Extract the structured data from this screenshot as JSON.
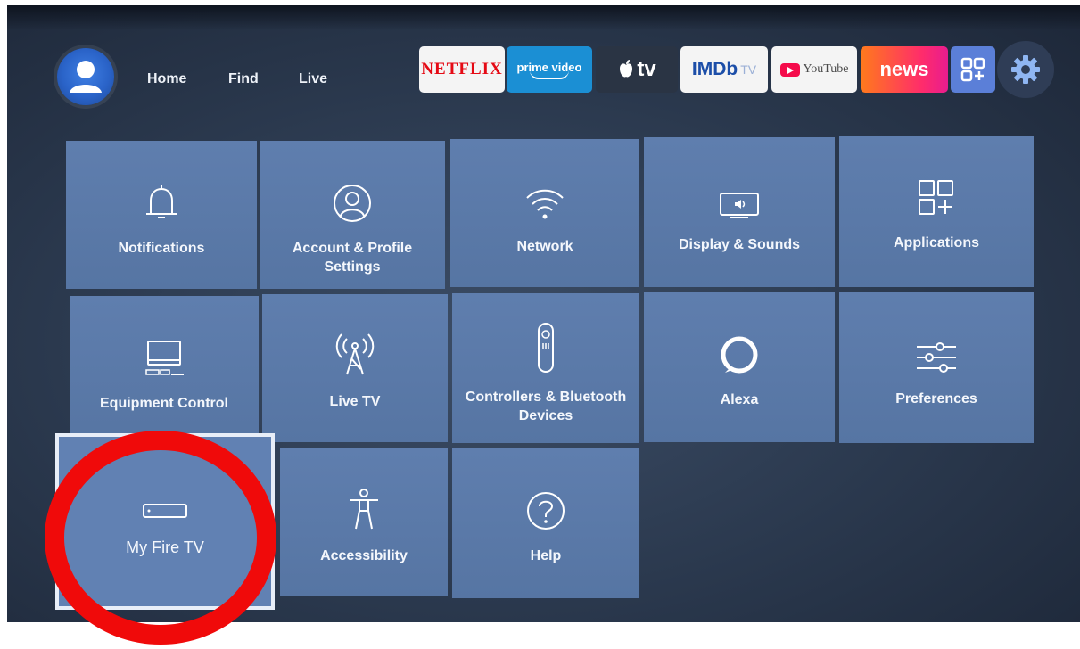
{
  "nav": {
    "links": [
      "Home",
      "Find",
      "Live"
    ]
  },
  "apps": {
    "netflix": "NETFLIX",
    "prime_top": "prime video",
    "appletv": "tv",
    "imdb": "IMDb",
    "imdb_tv": "TV",
    "youtube": "YouTube",
    "news": "news"
  },
  "tiles": [
    {
      "label": "Notifications",
      "icon": "bell-icon"
    },
    {
      "label": "Account & Profile Settings",
      "icon": "user-circle-icon"
    },
    {
      "label": "Network",
      "icon": "wifi-icon"
    },
    {
      "label": "Display & Sounds",
      "icon": "tv-speaker-icon"
    },
    {
      "label": "Applications",
      "icon": "apps-grid-icon"
    },
    {
      "label": "Equipment Control",
      "icon": "monitor-icon"
    },
    {
      "label": "Live TV",
      "icon": "antenna-icon"
    },
    {
      "label": "Controllers & Bluetooth Devices",
      "icon": "remote-icon"
    },
    {
      "label": "Alexa",
      "icon": "alexa-ring-icon"
    },
    {
      "label": "Preferences",
      "icon": "sliders-icon"
    },
    {
      "label": "My Fire TV",
      "icon": "fire-tv-stick-icon"
    },
    {
      "label": "Accessibility",
      "icon": "accessibility-icon"
    },
    {
      "label": "Help",
      "icon": "help-icon"
    }
  ],
  "colors": {
    "tile": "#5a79a8",
    "highlight_ring": "#f00a0a",
    "background": "#2a384d"
  }
}
